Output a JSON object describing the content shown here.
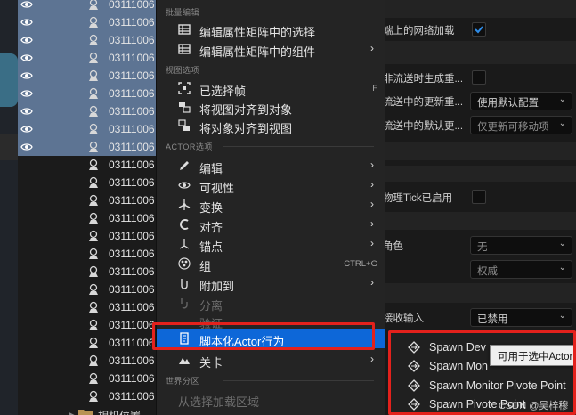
{
  "outliner": {
    "rows": [
      {
        "label": "03111006",
        "selected": true
      },
      {
        "label": "03111006",
        "selected": true
      },
      {
        "label": "03111006",
        "selected": true
      },
      {
        "label": "03111006",
        "selected": true
      },
      {
        "label": "03111006",
        "selected": true
      },
      {
        "label": "03111006",
        "selected": true
      },
      {
        "label": "03111006",
        "selected": true
      },
      {
        "label": "03111006",
        "selected": true
      },
      {
        "label": "03111006",
        "selected": true
      },
      {
        "label": "03111006",
        "selected": false
      },
      {
        "label": "03111006",
        "selected": false
      },
      {
        "label": "03111006",
        "selected": false
      },
      {
        "label": "03111006",
        "selected": false
      },
      {
        "label": "03111006",
        "selected": false
      },
      {
        "label": "03111006",
        "selected": false
      },
      {
        "label": "03111006",
        "selected": false
      },
      {
        "label": "03111006",
        "selected": false
      },
      {
        "label": "03111006",
        "selected": false
      },
      {
        "label": "03111006",
        "selected": false
      },
      {
        "label": "03111006",
        "selected": false
      },
      {
        "label": "03111006",
        "selected": false
      },
      {
        "label": "03111006",
        "selected": false
      },
      {
        "label": "03111006",
        "selected": false
      }
    ],
    "folder_label": "相机位置"
  },
  "menu": {
    "sections": {
      "batch_edit": "批量编辑",
      "view_options": "视图选项",
      "actor": "ACTOR选项",
      "world_partition": "世界分区"
    },
    "items": {
      "edit_selection_matrix": "编辑属性矩阵中的选择",
      "edit_component_matrix": "编辑属性矩阵中的组件",
      "selected_frame": "已选择帧",
      "align_view_to_object": "将视图对齐到对象",
      "align_object_to_view": "将对象对齐到视图",
      "edit": "编辑",
      "visibility": "可视性",
      "transform": "变换",
      "align": "对齐",
      "pivot": "锚点",
      "group": "组",
      "group_shortcut": "CTRL+G",
      "attach_to": "附加到",
      "detach": "分离",
      "verify": "验证",
      "script_actor_behavior": "脚本化Actor行为",
      "level": "关卡",
      "load_from_selection": "从选择加载区域",
      "selected_frame_shortcut": "F"
    }
  },
  "submenu": {
    "items": [
      "Spawn Dev",
      "Spawn Mon",
      "Spawn Monitor Pivote Point",
      "Spawn Pivote Point"
    ]
  },
  "tooltip": "可用于选中Actor",
  "details": {
    "rows": {
      "net_load_label": "端上的网络加载",
      "non_stream_label": "非流送时生成重...",
      "update_label": "流送中的更新重...",
      "update_value": "使用默认配置",
      "default_update_label": "流送中的默认更...",
      "default_update_value": "仅更新可移动项",
      "physics_tick_label": "物理Tick已启用",
      "role_label": "角色",
      "role_value": "无",
      "remote_role_value": "权威",
      "receive_input_label": "接收输入",
      "receive_input_value": "已禁用"
    }
  },
  "watermark": "CSDN @吴梓穆",
  "colors": {
    "highlight": "#0d67d8",
    "annotation": "#e3211c",
    "selection": "#5d7493"
  }
}
